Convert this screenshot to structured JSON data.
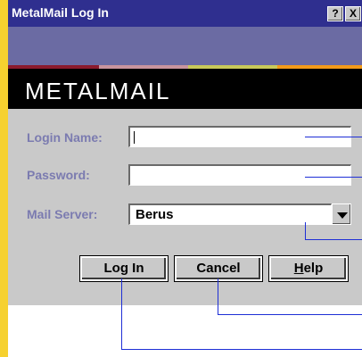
{
  "window": {
    "title": "MetalMail Log In",
    "help_button": "?",
    "close_button": "X"
  },
  "brand": {
    "logo_text": "METALMAIL"
  },
  "form": {
    "login_label": "Login Name:",
    "login_value": "",
    "password_label": "Password:",
    "password_value": "",
    "server_label": "Mail Server:",
    "server_value": "Berus"
  },
  "buttons": {
    "login": "Log In",
    "cancel": "Cancel",
    "help_pre": "",
    "help_mnemonic": "H",
    "help_post": "elp"
  },
  "colors": {
    "title_bar": "#2f2f8f",
    "band": "#6b6ba3",
    "stripe_colors": [
      "#8b1a2d",
      "#c9949e",
      "#c9c95a",
      "#f29a1b"
    ],
    "callout_line": "#1e2fd6",
    "label_text": "#7b7bb0"
  }
}
